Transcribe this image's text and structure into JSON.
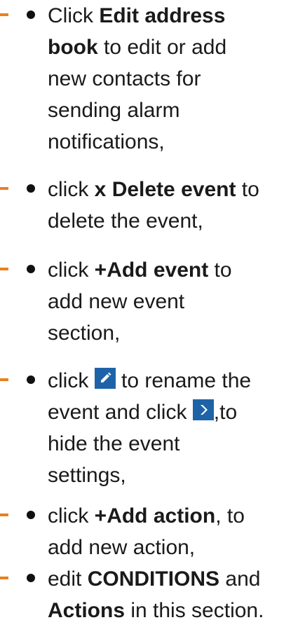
{
  "accent_color": "#e8801f",
  "icon_color": "#1e63a8",
  "items": [
    {
      "lines": [
        {
          "a": "Click ",
          "b": "Edit address",
          "c": ""
        },
        {
          "a": "",
          "b": "book",
          "c": " to edit or add"
        },
        {
          "a": "new contacts for",
          "b": "",
          "c": ""
        },
        {
          "a": "sending alarm",
          "b": "",
          "c": ""
        },
        {
          "a": "notifications,",
          "b": "",
          "c": ""
        }
      ]
    },
    {
      "lines": [
        {
          "a": "click ",
          "b": "x Delete event",
          "c": " to"
        },
        {
          "a": "delete the event,",
          "b": "",
          "c": ""
        }
      ]
    },
    {
      "lines": [
        {
          "a": "click ",
          "b": "+Add event",
          "c": " to"
        },
        {
          "a": "add new event",
          "b": "",
          "c": ""
        },
        {
          "a": "section,",
          "b": "",
          "c": ""
        }
      ]
    },
    {
      "line1_before": "click ",
      "edit_icon": "pencil-icon",
      "line1_after": " to rename the",
      "line2_before": "event and click ",
      "hide_icon": "chevron-right-icon",
      "line2_after": ",to",
      "line3": "hide the event",
      "line4": "settings,"
    },
    {
      "lines": [
        {
          "a": "click ",
          "b": "+Add action",
          "c": ", to"
        },
        {
          "a": "add new action,",
          "b": "",
          "c": ""
        }
      ]
    },
    {
      "lines": [
        {
          "a": "edit ",
          "b": "CONDITIONS",
          "c": " and"
        },
        {
          "a": "",
          "b": "Actions",
          "c": " in this section."
        }
      ]
    }
  ]
}
